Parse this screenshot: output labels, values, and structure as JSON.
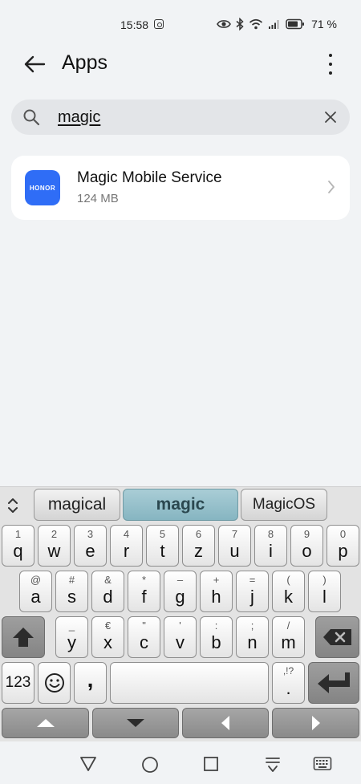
{
  "status_bar": {
    "time": "15:58",
    "battery_percent": "71 %"
  },
  "app_bar": {
    "title": "Apps"
  },
  "search": {
    "query": "magic"
  },
  "results": [
    {
      "icon_text": "HONOR",
      "name": "Magic Mobile Service",
      "size": "124 MB"
    }
  ],
  "keyboard": {
    "suggestions": [
      "magical",
      "magic",
      "MagicOS"
    ],
    "row1": [
      {
        "main": "q",
        "sub": "1"
      },
      {
        "main": "w",
        "sub": "2"
      },
      {
        "main": "e",
        "sub": "3"
      },
      {
        "main": "r",
        "sub": "4"
      },
      {
        "main": "t",
        "sub": "5"
      },
      {
        "main": "z",
        "sub": "6"
      },
      {
        "main": "u",
        "sub": "7"
      },
      {
        "main": "i",
        "sub": "8"
      },
      {
        "main": "o",
        "sub": "9"
      },
      {
        "main": "p",
        "sub": "0"
      }
    ],
    "row2": [
      {
        "main": "a",
        "sub": "@"
      },
      {
        "main": "s",
        "sub": "#"
      },
      {
        "main": "d",
        "sub": "&"
      },
      {
        "main": "f",
        "sub": "*"
      },
      {
        "main": "g",
        "sub": "–"
      },
      {
        "main": "h",
        "sub": "+"
      },
      {
        "main": "j",
        "sub": "="
      },
      {
        "main": "k",
        "sub": "("
      },
      {
        "main": "l",
        "sub": ")"
      }
    ],
    "row3": [
      {
        "main": "y",
        "sub": "_"
      },
      {
        "main": "x",
        "sub": "€"
      },
      {
        "main": "c",
        "sub": "\""
      },
      {
        "main": "v",
        "sub": "'"
      },
      {
        "main": "b",
        "sub": ":"
      },
      {
        "main": "n",
        "sub": ";"
      },
      {
        "main": "m",
        "sub": "/"
      }
    ],
    "numbers_label": "123",
    "comma_label": ",",
    "period_label": ".",
    "period_sub": ",!?"
  },
  "colors": {
    "accent_icon": "#2f6df6",
    "suggestion_selected": "#94bfc9"
  }
}
